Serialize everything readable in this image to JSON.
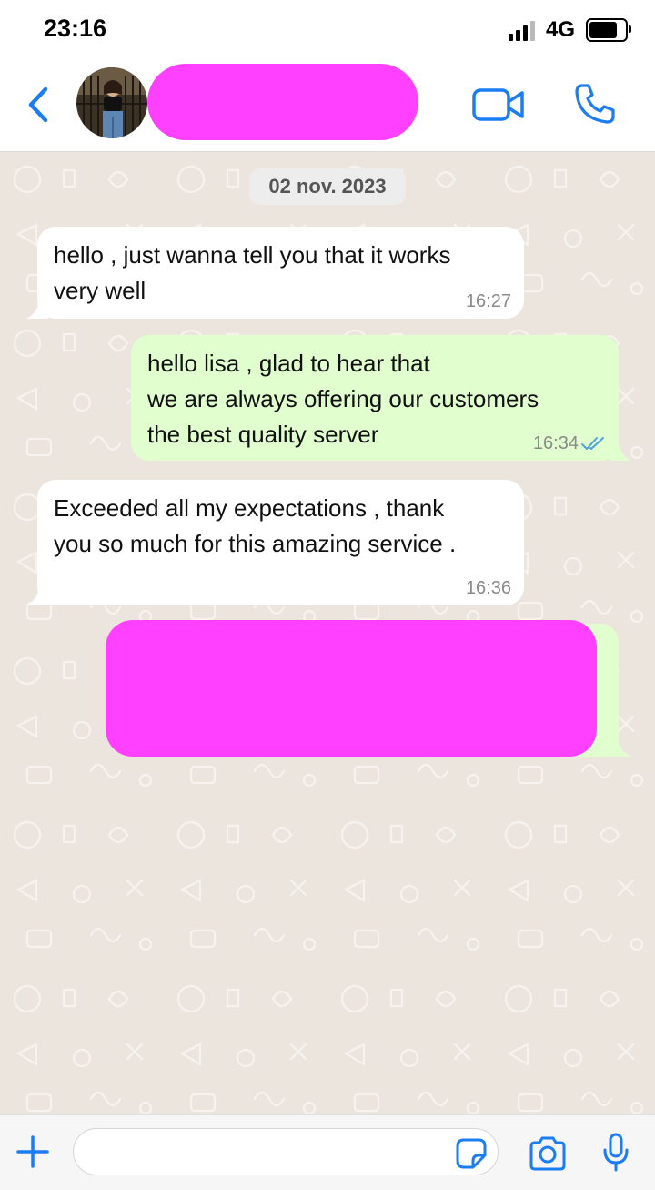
{
  "status_bar": {
    "time": "23:16",
    "network": "4G"
  },
  "header": {
    "contact_name": "",
    "back_icon": "chevron-left-icon",
    "video_icon": "video-camera-icon",
    "call_icon": "phone-icon"
  },
  "chat": {
    "date_label": "02 nov. 2023",
    "messages": [
      {
        "direction": "incoming",
        "text": "hello , just wanna tell you that it works\nvery well",
        "time": "16:27"
      },
      {
        "direction": "outgoing",
        "text": "hello lisa , glad to hear that\nwe are always offering our customers\nthe best quality server",
        "time": "16:34",
        "status": "read"
      },
      {
        "direction": "incoming",
        "text": "Exceeded all my expectations , thank\nyou so much for this amazing service .",
        "time": "16:36"
      },
      {
        "direction": "outgoing",
        "text": "",
        "time": "",
        "redacted": true
      }
    ]
  },
  "input_bar": {
    "message_value": "",
    "placeholder": ""
  },
  "colors": {
    "accent": "#1C7CF2",
    "outgoing_bubble": "#E1FECF",
    "incoming_bubble": "#FFFFFF",
    "redaction": "#FF40FF",
    "chat_background": "#ECE5DD"
  }
}
